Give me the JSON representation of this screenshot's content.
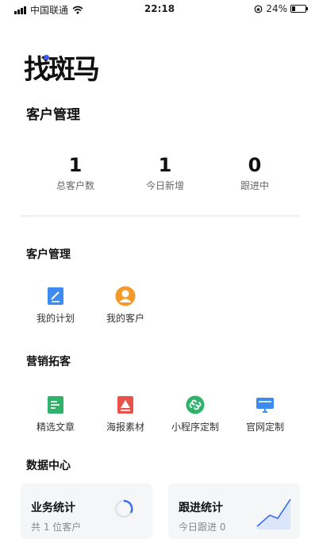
{
  "status_bar": {
    "carrier": "中国联通",
    "time": "22:18",
    "battery": "24%",
    "battery_level": 0.24
  },
  "brand": {
    "logo_text": "找斑马",
    "accent": "#3a57e8"
  },
  "page_title": "客户管理",
  "stats": [
    {
      "value": "1",
      "label": "总客户数"
    },
    {
      "value": "1",
      "label": "今日新增"
    },
    {
      "value": "0",
      "label": "跟进中"
    }
  ],
  "customer_section": {
    "title": "客户管理",
    "items": [
      {
        "label": "我的计划",
        "icon": "plan-icon",
        "color": "#3d8bf2"
      },
      {
        "label": "我的客户",
        "icon": "customer-icon",
        "color": "#f39a2b"
      }
    ]
  },
  "marketing_section": {
    "title": "营销拓客",
    "items": [
      {
        "label": "精选文章",
        "icon": "article-icon",
        "color": "#2fb36a"
      },
      {
        "label": "海报素材",
        "icon": "poster-icon",
        "color": "#e9524a"
      },
      {
        "label": "小程序定制",
        "icon": "mini-program-icon",
        "color": "#2fb36a"
      },
      {
        "label": "官网定制",
        "icon": "website-icon",
        "color": "#3d8bf2"
      }
    ]
  },
  "data_center": {
    "title": "数据中心",
    "cards": [
      {
        "title": "业务统计",
        "subtitle": "共 1 位客户"
      },
      {
        "title": "跟进统计",
        "subtitle": "今日跟进 0"
      }
    ]
  }
}
